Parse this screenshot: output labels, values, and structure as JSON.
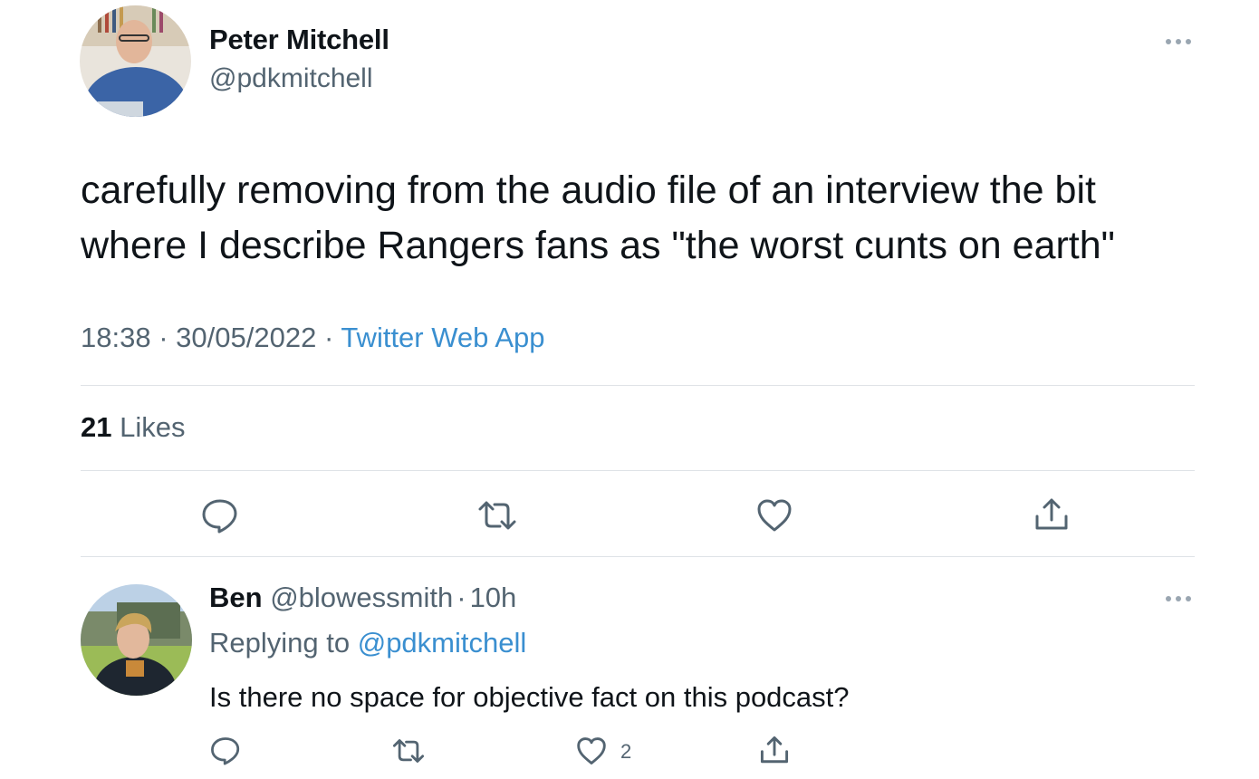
{
  "tweet": {
    "author_name": "Peter Mitchell",
    "author_handle": "@pdkmitchell",
    "more_icon": "more-horizontal-icon",
    "text": "carefully removing from the audio file of an interview the bit where I describe Rangers fans as \"the worst cunts on earth\"",
    "time": "18:38",
    "date": "30/05/2022",
    "source": "Twitter Web App",
    "sep": "·",
    "likes_count": "21",
    "likes_label": "Likes"
  },
  "actions": {
    "icons": [
      "reply-icon",
      "retweet-icon",
      "like-icon",
      "share-icon"
    ]
  },
  "reply": {
    "author_name": "Ben",
    "author_handle": "@blowessmith",
    "sep": "·",
    "time_ago": "10h",
    "replying_prefix": "Replying to",
    "replying_handle": "@pdkmitchell",
    "text": "Is there no space for objective fact on this podcast?",
    "like_count": "2"
  },
  "colors": {
    "link": "#3a8fd0",
    "secondary_text": "#536471",
    "divider": "#dfe3e7"
  }
}
